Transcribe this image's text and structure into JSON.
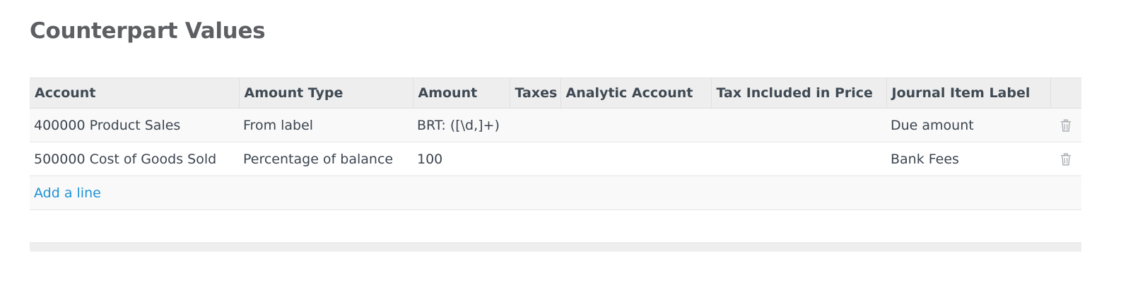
{
  "page": {
    "title": "Counterpart Values"
  },
  "table": {
    "columns": [
      "Account",
      "Amount Type",
      "Amount",
      "Taxes",
      "Analytic Account",
      "Tax Included in Price",
      "Journal Item Label",
      ""
    ],
    "rows": [
      {
        "account": "400000 Product Sales",
        "amount_type": "From label",
        "amount": "BRT: ([\\d,]+)",
        "taxes": "",
        "analytic_account": "",
        "tax_included": "",
        "label": "Due amount",
        "delete_icon": "trash-icon"
      },
      {
        "account": "500000 Cost of Goods Sold",
        "amount_type": "Percentage of balance",
        "amount": "100",
        "taxes": "",
        "analytic_account": "",
        "tax_included": "",
        "label": "Bank Fees",
        "delete_icon": "trash-icon"
      }
    ],
    "add_line_label": "Add a line"
  },
  "colors": {
    "link": "#1f93d6",
    "header_bg": "#eeeeee",
    "title": "#5d5f63"
  }
}
